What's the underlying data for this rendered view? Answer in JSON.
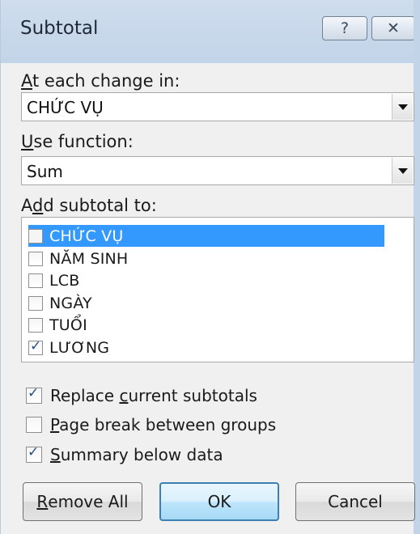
{
  "window": {
    "title": "Subtotal",
    "help_button": "?",
    "close_button": "✕"
  },
  "at_each_change": {
    "label_underlined": "A",
    "label_rest": "t each change in:",
    "value": "CHỨC VỤ"
  },
  "use_function": {
    "label_underlined": "U",
    "label_rest": "se function:",
    "value": "Sum"
  },
  "add_subtotal": {
    "label_pre": "A",
    "label_underlined": "d",
    "label_rest": "d subtotal to:",
    "items": [
      {
        "label": "CHỨC VỤ",
        "checked": false,
        "selected": true
      },
      {
        "label": "NĂM SINH",
        "checked": false,
        "selected": false
      },
      {
        "label": "LCB",
        "checked": false,
        "selected": false
      },
      {
        "label": "NGÀY",
        "checked": false,
        "selected": false
      },
      {
        "label": "TUỔI",
        "checked": false,
        "selected": false
      },
      {
        "label": "LƯƠNG",
        "checked": true,
        "selected": false
      }
    ]
  },
  "options": {
    "replace": {
      "pre": "Replace ",
      "underlined": "c",
      "rest": "urrent subtotals",
      "checked": true
    },
    "page_break": {
      "pre": "",
      "underlined": "P",
      "rest": "age break between groups",
      "checked": false
    },
    "summary": {
      "pre": "",
      "underlined": "S",
      "rest": "ummary below data",
      "checked": true
    }
  },
  "buttons": {
    "remove_underlined": "R",
    "remove_rest": "emove All",
    "ok": "OK",
    "cancel": "Cancel"
  }
}
